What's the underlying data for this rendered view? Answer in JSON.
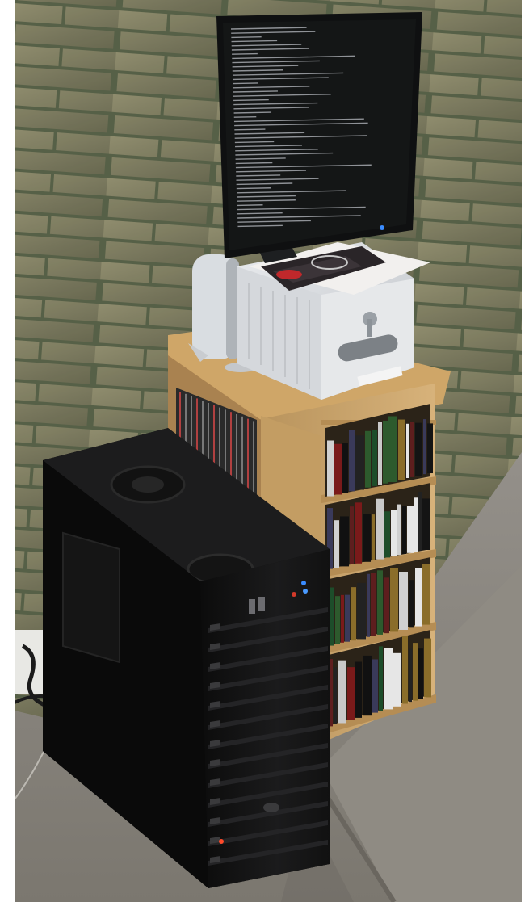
{
  "scene": {
    "label": "",
    "colors": {
      "brick": "#8c8a66",
      "mortar": "#5f6b4e",
      "carpet": "#8b877f",
      "shelf": "#c9a46a",
      "tower": "#141414",
      "monitor_screen": "#141616",
      "terminal_text": "#c8c8cc",
      "led_blue": "#3a8cff"
    },
    "objects": [
      "brick-wall",
      "carpet-floor",
      "bookshelf",
      "books",
      "cd-cases",
      "printer-scanner",
      "speaker",
      "monitor",
      "pc-tower",
      "power-cable"
    ]
  }
}
